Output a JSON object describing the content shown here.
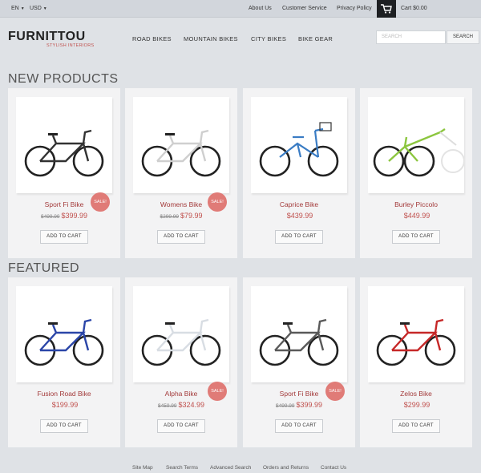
{
  "topbar": {
    "language": "EN",
    "currency": "USD",
    "links": [
      "About Us",
      "Customer Service",
      "Privacy Policy"
    ],
    "cart_text": "Cart $0.00"
  },
  "logo": {
    "name": "FURNITTOU",
    "tagline": "STYLISH INTERIORS"
  },
  "nav": [
    "ROAD BIKES",
    "MOUNTAIN BIKES",
    "CITY BIKES",
    "BIKE GEAR"
  ],
  "search": {
    "placeholder": "SEARCH",
    "button": "SEARCH"
  },
  "sections": [
    {
      "title": "NEW PRODUCTS",
      "products": [
        {
          "name": "Sport Fi Bike",
          "old_price": "$499.99",
          "price": "$399.99",
          "sale": "SALE!",
          "button": "ADD TO CART",
          "color": "#333333",
          "style": "road"
        },
        {
          "name": "Womens Bike",
          "old_price": "$299.99",
          "price": "$79.99",
          "sale": "SALE!",
          "button": "ADD TO CART",
          "color": "#cfcfcf",
          "style": "hybrid"
        },
        {
          "name": "Caprice Bike",
          "old_price": "",
          "price": "$439.99",
          "sale": "",
          "button": "ADD TO CART",
          "color": "#3a7cc4",
          "style": "city"
        },
        {
          "name": "Burley Piccolo",
          "old_price": "",
          "price": "$449.99",
          "sale": "",
          "button": "ADD TO CART",
          "color": "#8cc63f",
          "style": "trailer"
        }
      ]
    },
    {
      "title": "FEATURED",
      "products": [
        {
          "name": "Fusion Road Bike",
          "old_price": "",
          "price": "$199.99",
          "sale": "",
          "button": "ADD TO CART",
          "color": "#2b46a8",
          "style": "road"
        },
        {
          "name": "Alpha Bike",
          "old_price": "$459.99",
          "price": "$324.99",
          "sale": "SALE!",
          "button": "ADD TO CART",
          "color": "#d8dde3",
          "style": "road"
        },
        {
          "name": "Sport Fi Bike",
          "old_price": "$499.99",
          "price": "$399.99",
          "sale": "SALE!",
          "button": "ADD TO CART",
          "color": "#5a5a5a",
          "style": "road"
        },
        {
          "name": "Zelos Bike",
          "old_price": "",
          "price": "$299.99",
          "sale": "",
          "button": "ADD TO CART",
          "color": "#c62828",
          "style": "road"
        }
      ]
    }
  ],
  "footer": [
    "Site Map",
    "Search Terms",
    "Advanced Search",
    "Orders and Returns",
    "Contact Us"
  ]
}
